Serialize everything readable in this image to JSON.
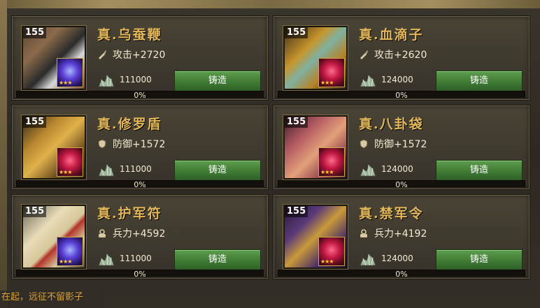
{
  "cards": [
    {
      "level": "155",
      "name": "真.乌蚕鞭",
      "stat_type": "attack",
      "stat": "攻击+2720",
      "cost": "111000",
      "button": "铸造",
      "progress": 0,
      "progress_label": "0%",
      "gem": "purple"
    },
    {
      "level": "155",
      "name": "真.血滴子",
      "stat_type": "attack",
      "stat": "攻击+2620",
      "cost": "124000",
      "button": "铸造",
      "progress": 0,
      "progress_label": "0%",
      "gem": "red"
    },
    {
      "level": "155",
      "name": "真.修罗盾",
      "stat_type": "defense",
      "stat": "防御+1572",
      "cost": "111000",
      "button": "铸造",
      "progress": 0,
      "progress_label": "0%",
      "gem": "red"
    },
    {
      "level": "155",
      "name": "真.八卦袋",
      "stat_type": "defense",
      "stat": "防御+1572",
      "cost": "124000",
      "button": "铸造",
      "progress": 0,
      "progress_label": "0%",
      "gem": "red"
    },
    {
      "level": "155",
      "name": "真.护军符",
      "stat_type": "troops",
      "stat": "兵力+4592",
      "cost": "111000",
      "button": "铸造",
      "progress": 0,
      "progress_label": "0%",
      "gem": "purple"
    },
    {
      "level": "155",
      "name": "真.禁军令",
      "stat_type": "troops",
      "stat": "兵力+4192",
      "cost": "124000",
      "button": "铸造",
      "progress": 0,
      "progress_label": "0%",
      "gem": "red"
    }
  ],
  "ticker": "在起，远征不留影子",
  "colors": {
    "title": "#e4b85a",
    "button": "#3f7b34",
    "progress": "#c9a13a"
  }
}
